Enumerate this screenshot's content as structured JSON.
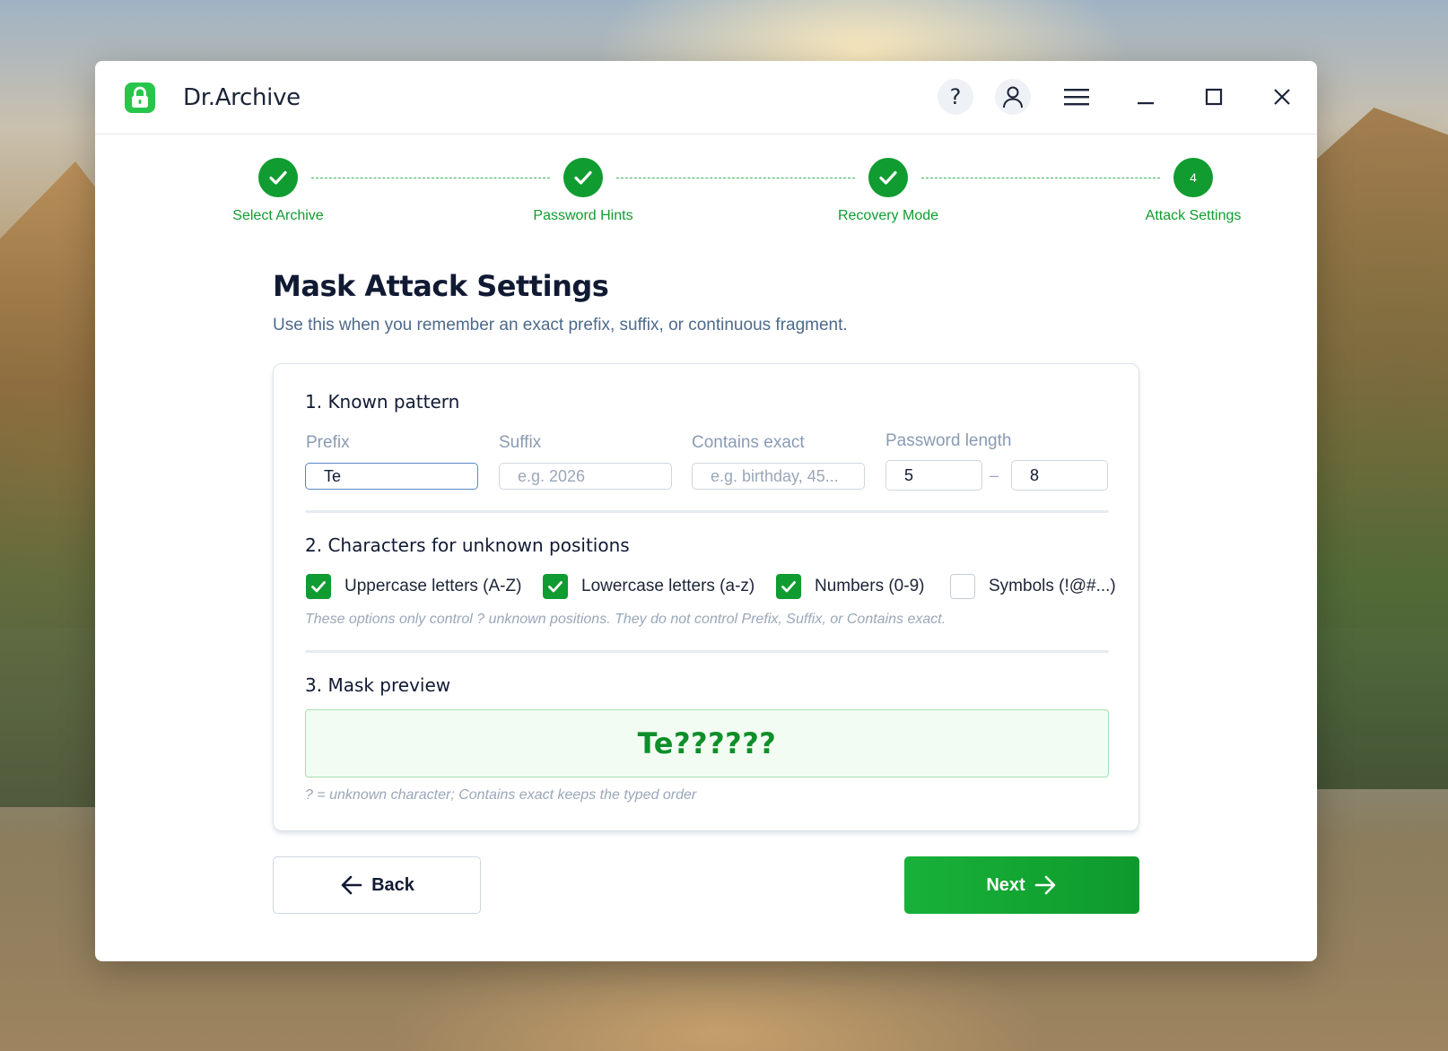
{
  "app": {
    "title": "Dr.Archive"
  },
  "titlebar": {
    "help_glyph": "?",
    "icons": [
      "question-icon",
      "user-icon",
      "hamburger-menu-icon",
      "minimize-icon",
      "maximize-icon",
      "close-icon"
    ]
  },
  "stepper": {
    "steps": [
      {
        "label": "Select Archive",
        "state": "done"
      },
      {
        "label": "Password Hints",
        "state": "done"
      },
      {
        "label": "Recovery Mode",
        "state": "done"
      },
      {
        "label": "Attack Settings",
        "state": "current",
        "number": "4"
      }
    ]
  },
  "page": {
    "title": "Mask Attack Settings",
    "subtitle": "Use this when you remember an exact prefix, suffix, or continuous fragment."
  },
  "known_pattern": {
    "title": "1. Known pattern",
    "prefix": {
      "label": "Prefix",
      "value": "Te",
      "placeholder": ""
    },
    "suffix": {
      "label": "Suffix",
      "value": "",
      "placeholder": "e.g. 2026"
    },
    "contains": {
      "label": "Contains exact",
      "value": "",
      "placeholder": "e.g. birthday, 45..."
    },
    "length": {
      "label": "Password length",
      "min": "5",
      "max": "8",
      "separator": "–"
    }
  },
  "charset": {
    "title": "2. Characters for unknown positions",
    "options": [
      {
        "label": "Uppercase letters (A-Z)",
        "checked": true
      },
      {
        "label": "Lowercase letters (a-z)",
        "checked": true
      },
      {
        "label": "Numbers (0-9)",
        "checked": true
      },
      {
        "label": "Symbols (!@#...)",
        "checked": false
      }
    ],
    "note": "These options only control ? unknown positions. They do not control Prefix, Suffix, or Contains exact."
  },
  "preview": {
    "title": "3. Mask preview",
    "mask": "Te??????",
    "note": "? = unknown character; Contains exact keeps the typed order"
  },
  "buttons": {
    "back": "Back",
    "next": "Next"
  },
  "colors": {
    "accent": "#109c30",
    "brand": "#27c64b",
    "heading": "#111a33"
  }
}
